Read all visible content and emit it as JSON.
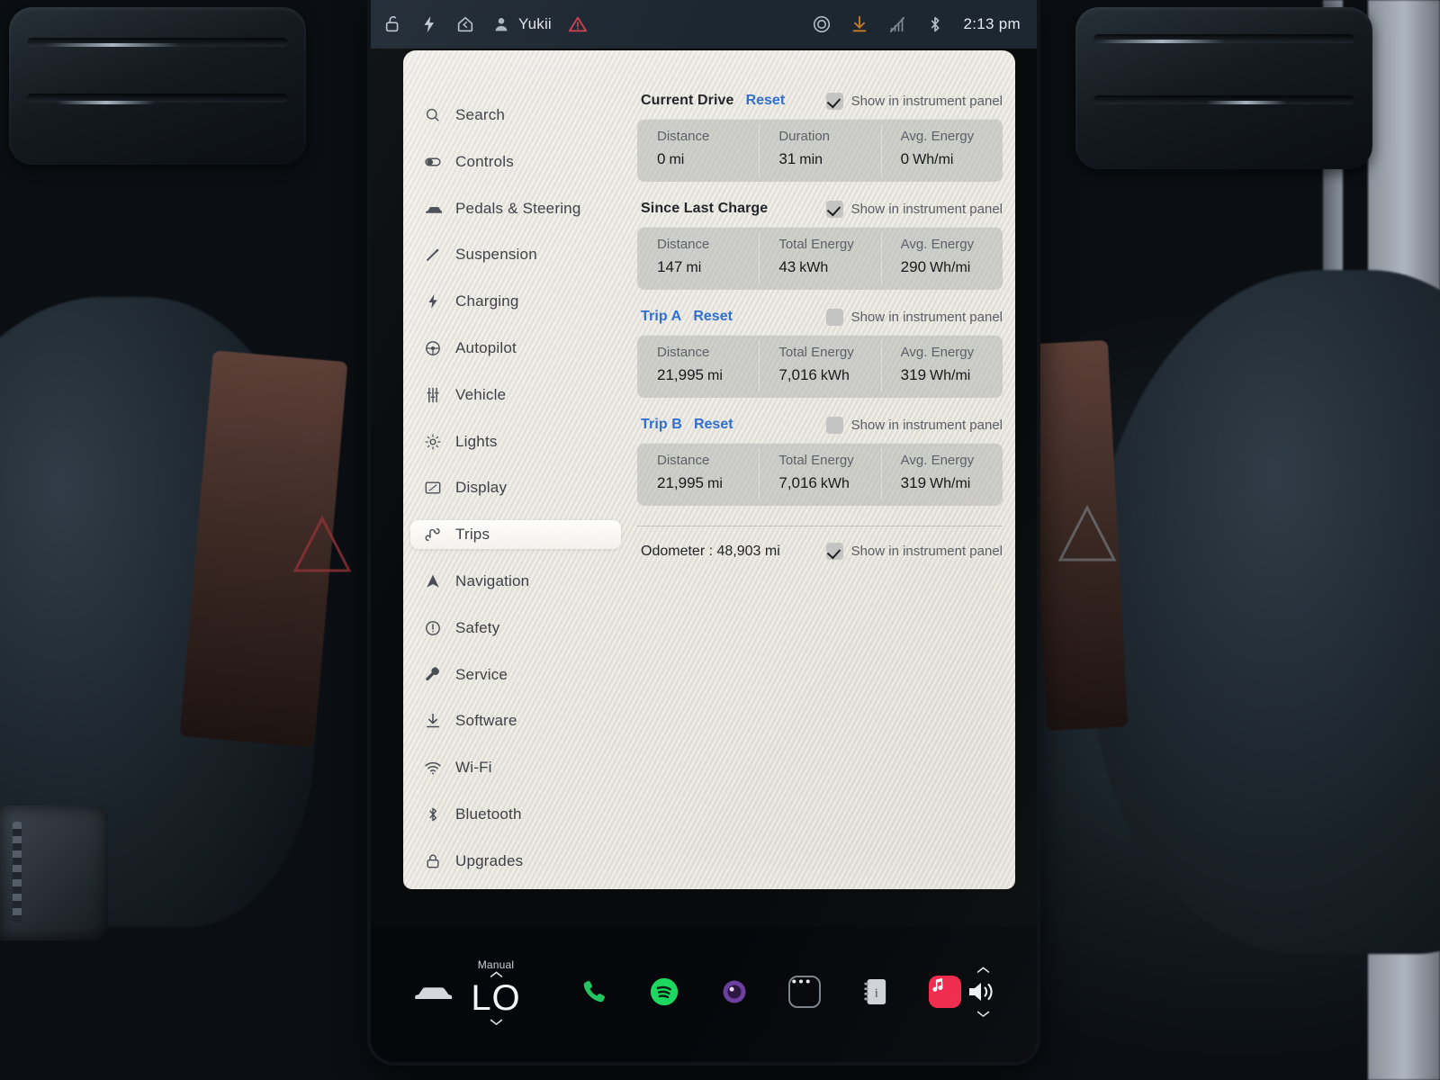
{
  "statusbar": {
    "left_icons": [
      "unlock-icon",
      "bolt-icon",
      "home-icon"
    ],
    "profile_name": "Yukii",
    "alert_icon": "warning-triangle-icon",
    "right_icons": [
      "recording-circle-icon",
      "download-icon",
      "cellular-off-icon",
      "bluetooth-icon"
    ],
    "time": "2:13 pm"
  },
  "sidebar": {
    "items": [
      {
        "label": "Search",
        "icon": "search-icon",
        "selected": false
      },
      {
        "label": "Controls",
        "icon": "toggle-icon",
        "selected": false
      },
      {
        "label": "Pedals & Steering",
        "icon": "car-icon",
        "selected": false
      },
      {
        "label": "Suspension",
        "icon": "shock-icon",
        "selected": false
      },
      {
        "label": "Charging",
        "icon": "bolt-icon",
        "selected": false
      },
      {
        "label": "Autopilot",
        "icon": "steering-icon",
        "selected": false
      },
      {
        "label": "Vehicle",
        "icon": "sliders-icon",
        "selected": false
      },
      {
        "label": "Lights",
        "icon": "sun-icon",
        "selected": false
      },
      {
        "label": "Display",
        "icon": "display-icon",
        "selected": false
      },
      {
        "label": "Trips",
        "icon": "trips-icon",
        "selected": true
      },
      {
        "label": "Navigation",
        "icon": "navigation-icon",
        "selected": false
      },
      {
        "label": "Safety",
        "icon": "alert-circle-icon",
        "selected": false
      },
      {
        "label": "Service",
        "icon": "wrench-icon",
        "selected": false
      },
      {
        "label": "Software",
        "icon": "download-icon",
        "selected": false
      },
      {
        "label": "Wi-Fi",
        "icon": "wifi-icon",
        "selected": false
      },
      {
        "label": "Bluetooth",
        "icon": "bluetooth-icon",
        "selected": false
      },
      {
        "label": "Upgrades",
        "icon": "lock-icon",
        "selected": false
      }
    ]
  },
  "trips": {
    "toggle_label": "Show in instrument panel",
    "reset_label": "Reset",
    "sections": [
      {
        "title": "Current Drive",
        "title_is_link": false,
        "has_reset": true,
        "show_in_panel": true,
        "stats": [
          {
            "label": "Distance",
            "value": "0",
            "unit": "mi"
          },
          {
            "label": "Duration",
            "value": "31",
            "unit": "min"
          },
          {
            "label": "Avg. Energy",
            "value": "0",
            "unit": "Wh/mi"
          }
        ]
      },
      {
        "title": "Since Last Charge",
        "title_is_link": false,
        "has_reset": false,
        "show_in_panel": true,
        "stats": [
          {
            "label": "Distance",
            "value": "147",
            "unit": "mi"
          },
          {
            "label": "Total Energy",
            "value": "43",
            "unit": "kWh"
          },
          {
            "label": "Avg. Energy",
            "value": "290",
            "unit": "Wh/mi"
          }
        ]
      },
      {
        "title": "Trip A",
        "title_is_link": true,
        "has_reset": true,
        "show_in_panel": false,
        "stats": [
          {
            "label": "Distance",
            "value": "21,995",
            "unit": "mi"
          },
          {
            "label": "Total Energy",
            "value": "7,016",
            "unit": "kWh"
          },
          {
            "label": "Avg. Energy",
            "value": "319",
            "unit": "Wh/mi"
          }
        ]
      },
      {
        "title": "Trip B",
        "title_is_link": true,
        "has_reset": true,
        "show_in_panel": false,
        "stats": [
          {
            "label": "Distance",
            "value": "21,995",
            "unit": "mi"
          },
          {
            "label": "Total Energy",
            "value": "7,016",
            "unit": "kWh"
          },
          {
            "label": "Avg. Energy",
            "value": "319",
            "unit": "Wh/mi"
          }
        ]
      }
    ],
    "odometer": {
      "text": "Odometer : 48,903 mi",
      "show_in_panel": true,
      "toggle_label": "Show in instrument panel"
    }
  },
  "dock": {
    "car_icon": "car-icon",
    "climate": {
      "mode_label": "Manual",
      "temperature": "LO"
    },
    "apps": [
      {
        "name": "phone-icon",
        "color": "#22c55e"
      },
      {
        "name": "spotify-icon",
        "color": "#1ed760"
      },
      {
        "name": "dashcam-icon",
        "color": "#7e4bb5"
      },
      {
        "name": "more-apps-icon",
        "color": "#e8eaec"
      },
      {
        "name": "media-card-icon",
        "color": "#c8cbcf"
      },
      {
        "name": "music-icon",
        "color": "#f0294b"
      }
    ],
    "volume_icon": "volume-icon"
  },
  "colors": {
    "accent_blue": "#2f6fd0",
    "panel_bg": "#e4e2da",
    "statusbar_bg": "#1d2731",
    "alert_red": "#d9414f",
    "download_orange": "#d6821f"
  }
}
